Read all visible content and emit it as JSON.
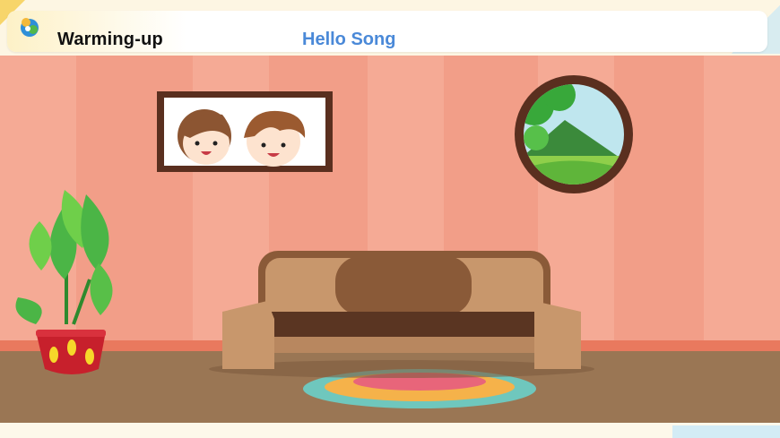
{
  "header": {
    "section_label": "Warming-up",
    "lesson_title": "Hello Song"
  },
  "icons": {
    "logo": "logo-icon"
  },
  "colors": {
    "wall": "#f29e88",
    "wall_stripe": "#f5a893",
    "baseboard": "#e9795e",
    "floor": "#9a7654",
    "sofa": "#c8976c",
    "sofa_dark": "#8a5a38",
    "accent_blue": "#4a89d8"
  }
}
